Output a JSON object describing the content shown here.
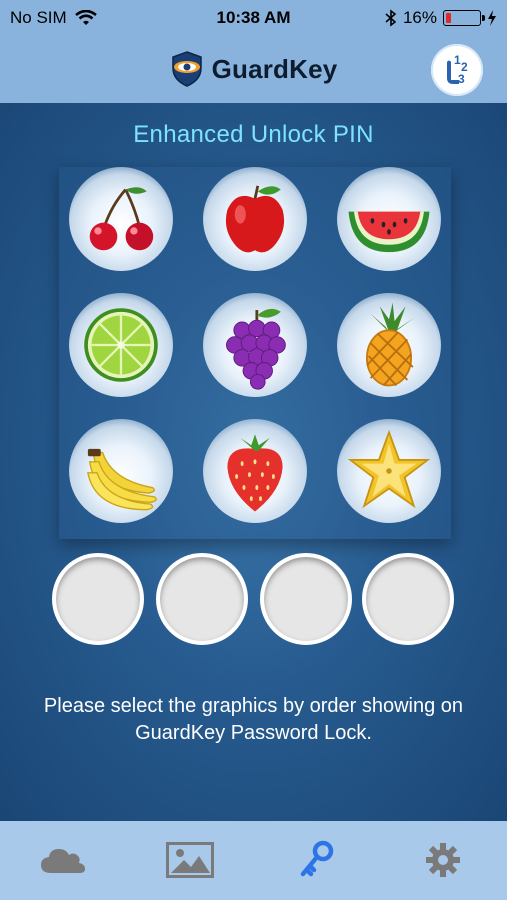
{
  "status_bar": {
    "carrier": "No SIM",
    "time": "10:38 AM",
    "battery_percent": "16%",
    "battery_level": 0.16,
    "battery_color": "#e02a2a"
  },
  "nav": {
    "app_name": "GuardKey",
    "pin_button_icon": "pin-123-icon"
  },
  "main": {
    "title": "Enhanced Unlock PIN",
    "fruits": [
      {
        "name": "cherry"
      },
      {
        "name": "apple"
      },
      {
        "name": "watermelon"
      },
      {
        "name": "lime"
      },
      {
        "name": "grapes"
      },
      {
        "name": "pineapple"
      },
      {
        "name": "banana"
      },
      {
        "name": "strawberry"
      },
      {
        "name": "starfruit"
      }
    ],
    "slot_count": 4,
    "hint": "Please select the graphics by order showing on GuardKey Password Lock."
  },
  "tabbar": {
    "items": [
      {
        "icon": "cloud-icon",
        "active": false
      },
      {
        "icon": "image-icon",
        "active": false
      },
      {
        "icon": "key-icon",
        "active": true
      },
      {
        "icon": "gear-icon",
        "active": false
      }
    ],
    "active_color": "#2d74e6",
    "inactive_color": "#7a7a7a"
  }
}
